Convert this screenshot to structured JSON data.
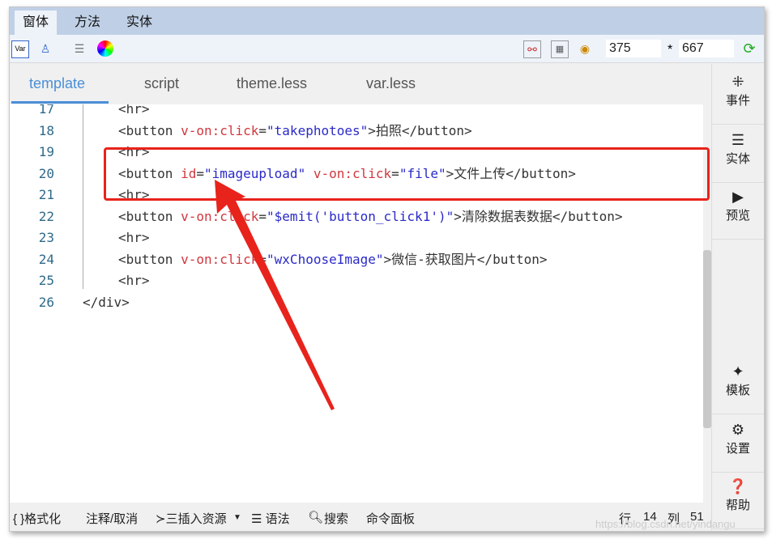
{
  "menu": {
    "tabs": [
      "窗体",
      "方法",
      "实体"
    ],
    "active": 0
  },
  "toolbar": {
    "width": "375",
    "separator": "*",
    "height": "667",
    "left_icons": [
      "var-icon",
      "component-tree-icon",
      "database-icon",
      "color-wheel-icon"
    ],
    "right_icons": [
      "chart-icon",
      "qrcode-icon",
      "eye-icon",
      "refresh-icon"
    ]
  },
  "editor": {
    "tabs": [
      "template",
      "script",
      "theme.less",
      "var.less"
    ],
    "active": 0,
    "lines": [
      {
        "n": "17",
        "parts": [
          [
            "t",
            "<hr>"
          ]
        ]
      },
      {
        "n": "18",
        "parts": [
          [
            "t",
            "<button "
          ],
          [
            "a",
            "v-on:click"
          ],
          [
            "t",
            "="
          ],
          [
            "v",
            "\"takephotoes\""
          ],
          [
            "t",
            ">拍照</button>"
          ]
        ]
      },
      {
        "n": "19",
        "parts": [
          [
            "t",
            "<hr>"
          ]
        ]
      },
      {
        "n": "20",
        "parts": [
          [
            "t",
            "<button "
          ],
          [
            "a",
            "id"
          ],
          [
            "t",
            "="
          ],
          [
            "v",
            "\"imageupload\""
          ],
          [
            "t",
            " "
          ],
          [
            "a",
            "v-on:click"
          ],
          [
            "t",
            "="
          ],
          [
            "v",
            "\"file\""
          ],
          [
            "t",
            ">文件上传</button>"
          ]
        ]
      },
      {
        "n": "21",
        "parts": [
          [
            "t",
            "<hr>"
          ]
        ]
      },
      {
        "n": "22",
        "parts": [
          [
            "t",
            "<button "
          ],
          [
            "a",
            "v-on:click"
          ],
          [
            "t",
            "="
          ],
          [
            "v",
            "\"$emit('button_click1')\""
          ],
          [
            "t",
            ">清除数据表数据</button>"
          ]
        ]
      },
      {
        "n": "23",
        "parts": [
          [
            "t",
            "<hr>"
          ]
        ]
      },
      {
        "n": "24",
        "parts": [
          [
            "t",
            "<button "
          ],
          [
            "a",
            "v-on:click"
          ],
          [
            "t",
            "="
          ],
          [
            "v",
            "\"wxChooseImage\""
          ],
          [
            "t",
            ">微信-获取图片</button>"
          ]
        ]
      },
      {
        "n": "25",
        "parts": [
          [
            "t",
            "<hr>"
          ]
        ]
      },
      {
        "n": "26",
        "parts": [
          [
            "t",
            "</div>"
          ]
        ]
      }
    ]
  },
  "sidebar": [
    {
      "label": "事件",
      "icon": "cursor-click-icon"
    },
    {
      "label": "实体",
      "icon": "database-icon"
    },
    {
      "label": "预览",
      "icon": "play-icon"
    },
    {
      "label": "模板",
      "icon": "magic-wand-icon"
    },
    {
      "label": "设置",
      "icon": "gear-icon"
    },
    {
      "label": "帮助",
      "icon": "help-icon"
    }
  ],
  "status": {
    "format": "{ }格式化",
    "comment": "注释/取消",
    "insert": "≻三插入资源",
    "syntax": "☰ 语法",
    "search": "搜索",
    "command": "命令面板",
    "row_label": "行",
    "row": "14",
    "col_label": "列",
    "col": "51"
  },
  "annotation": {
    "color": "#e8231c"
  },
  "watermark": "https://blog.csdn.net/yindangu"
}
